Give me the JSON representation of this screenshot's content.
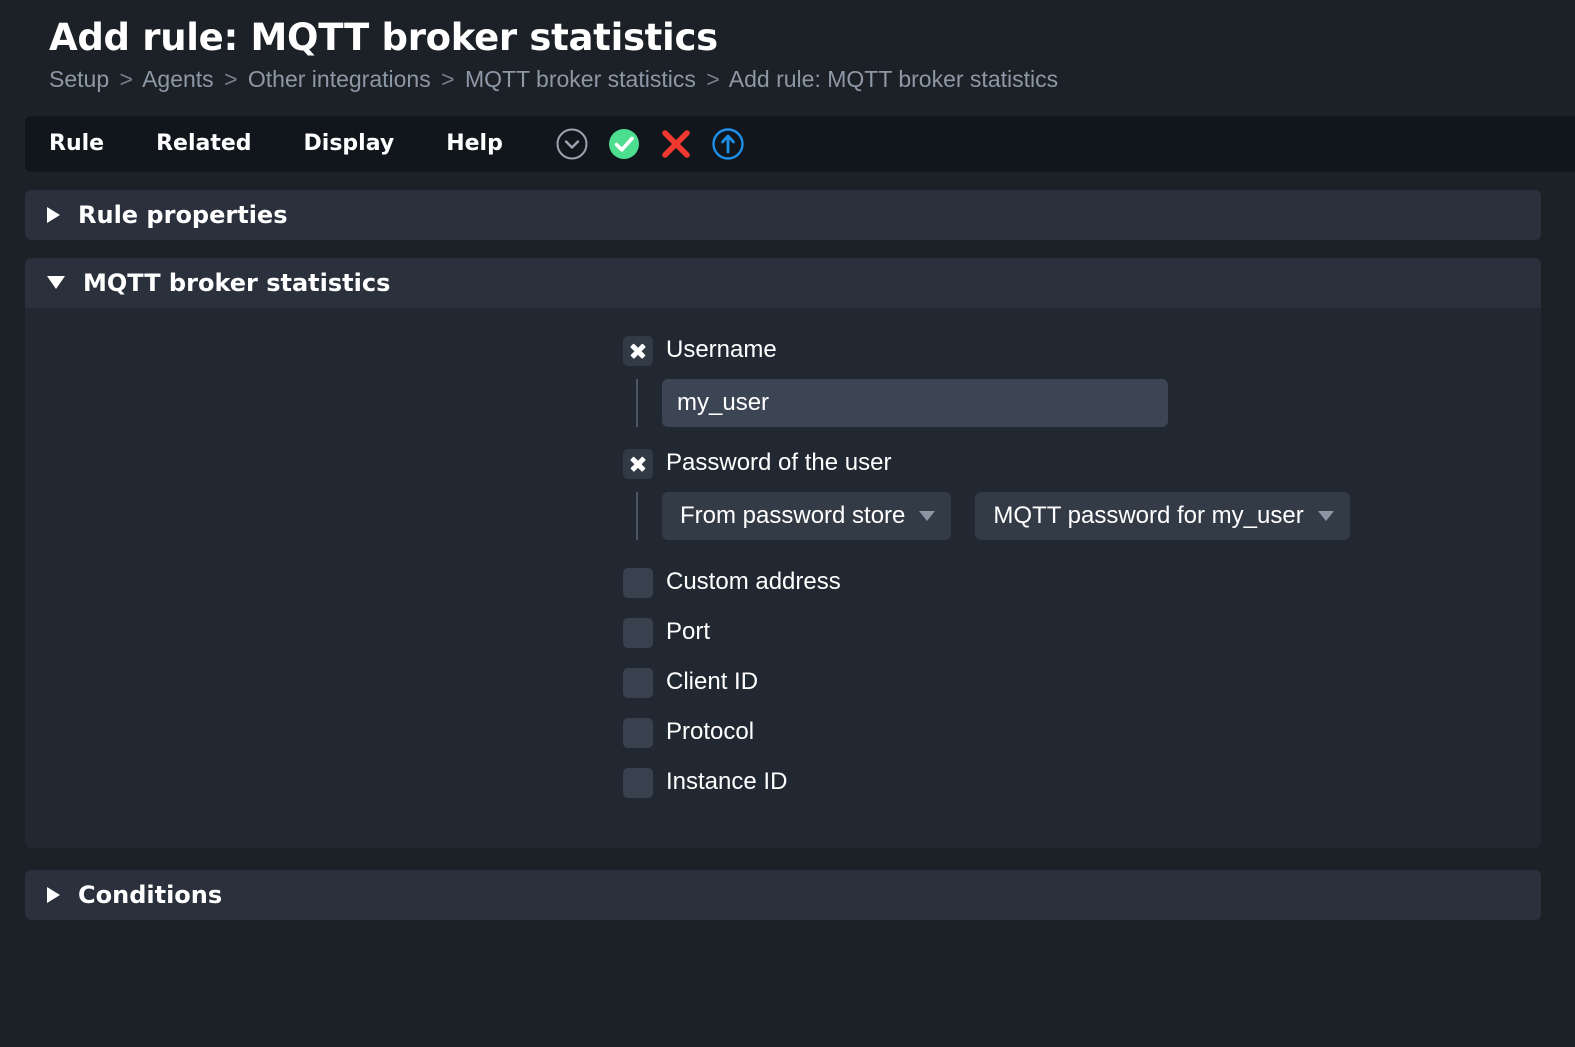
{
  "header": {
    "title": "Add rule: MQTT broker statistics",
    "breadcrumb": [
      "Setup",
      "Agents",
      "Other integrations",
      "MQTT broker statistics",
      "Add rule: MQTT broker statistics"
    ],
    "breadcrumb_separator": ">"
  },
  "toolbar": {
    "menus": [
      {
        "label": "Rule"
      },
      {
        "label": "Related"
      },
      {
        "label": "Display"
      },
      {
        "label": "Help"
      }
    ],
    "icons": [
      {
        "name": "chevron-down-circle-icon",
        "color": "#9aa3ae"
      },
      {
        "name": "save-check-icon",
        "color": "#4ede8f"
      },
      {
        "name": "cancel-x-icon",
        "color": "#f2392f"
      },
      {
        "name": "upload-arrow-up-icon",
        "color": "#1e8fe8"
      }
    ]
  },
  "sections": {
    "rule_properties": {
      "title": "Rule properties",
      "expanded": false
    },
    "mqtt": {
      "title": "MQTT broker statistics",
      "expanded": true
    },
    "conditions": {
      "title": "Conditions",
      "expanded": false
    }
  },
  "form": {
    "username": {
      "label": "Username",
      "checked": true,
      "value": "my_user",
      "placeholder": ""
    },
    "password": {
      "label": "Password of the user",
      "checked": true,
      "source_option": "From password store",
      "store_entry": "MQTT password for my_user"
    },
    "options": [
      {
        "label": "Custom address",
        "checked": false
      },
      {
        "label": "Port",
        "checked": false
      },
      {
        "label": "Client ID",
        "checked": false
      },
      {
        "label": "Protocol",
        "checked": false
      },
      {
        "label": "Instance ID",
        "checked": false
      }
    ]
  }
}
